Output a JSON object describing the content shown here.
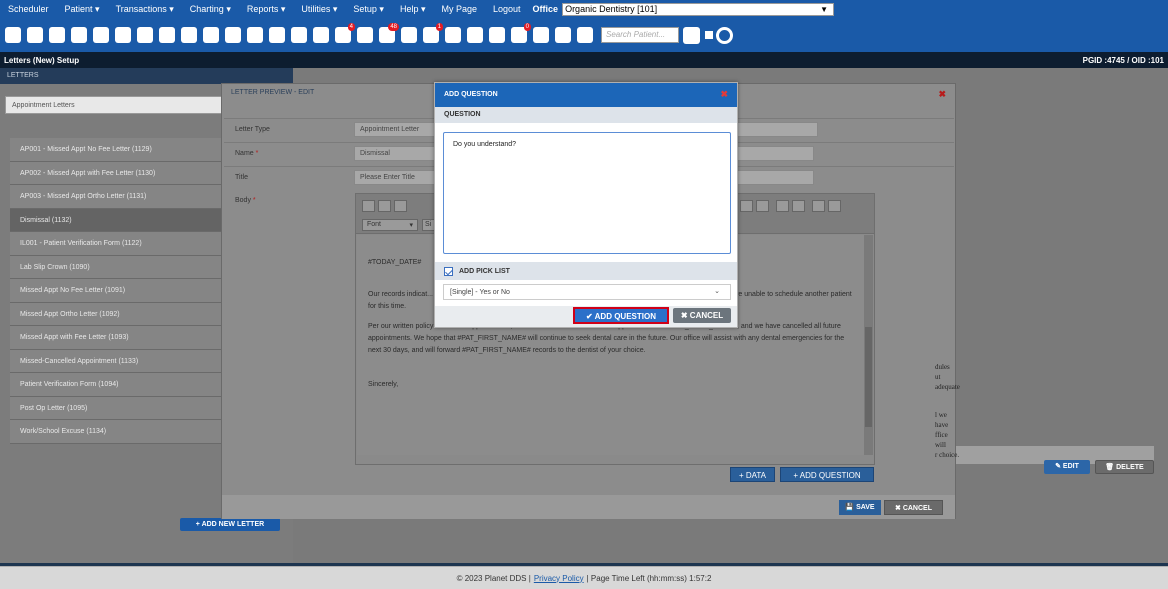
{
  "menu": {
    "items": [
      "Scheduler",
      "Patient ▾",
      "Transactions ▾",
      "Charting ▾",
      "Reports ▾",
      "Utilities ▾",
      "Setup ▾",
      "Help ▾",
      "My Page",
      "Logout"
    ],
    "office_label": "Office",
    "office_value": "Organic Dentistry [101]"
  },
  "toolbar": {
    "icons": [
      "calendar-icon",
      "home-icon",
      "dollar-icon",
      "pen-icon",
      "tooth-icon",
      "tooth-chart-icon",
      "pn-icon",
      "tx-icon",
      "family-icon",
      "family-check-icon",
      "rx-icon",
      "notes-icon",
      "printer-icon",
      "forms-icon",
      "message-icon",
      "sms-icon",
      "clock-icon",
      "globe-icon",
      "recall-icon",
      "web-icon",
      "tooth-box-icon",
      "question-box-icon",
      "settings-icon",
      "report-icon",
      "office-icon",
      "print-icon",
      "checkbox-icon"
    ],
    "badges": {
      "sms": "4",
      "globe": "48",
      "web": "1",
      "report": "0",
      "tooth": "0"
    },
    "search_placeholder": "Search Patient..."
  },
  "header": {
    "title": "Letters (New) Setup",
    "pgid": "PGID :4745 / OID :101"
  },
  "letters": {
    "heading": "LETTERS",
    "category": "Appointment Letters",
    "items": [
      "AP001 - Missed Appt No Fee Letter (1129)",
      "AP002 - Missed Appt with Fee Letter (1130)",
      "AP003 - Missed Appt Ortho Letter (1131)",
      "Dismissal (1132)",
      "IL001 - Patient Verification Form (1122)",
      "Lab Slip Crown (1090)",
      "Missed Appt No Fee Letter (1091)",
      "Missed Appt Ortho Letter (1092)",
      "Missed Appt with Fee Letter (1093)",
      "Missed-Cancelled Appointment (1133)",
      "Patient Verification Form (1094)",
      "Post Op Letter (1095)",
      "Work/School Excuse (1134)"
    ],
    "add_new": "+ ADD NEW LETTER"
  },
  "preview": {
    "title": "LETTER PREVIEW - EDIT",
    "close": "✖",
    "letter_type_label": "Letter Type",
    "letter_type_value": "Appointment Letter",
    "name_label": "Name",
    "name_value": "Dismissal",
    "title_label": "Title",
    "title_placeholder": "Please Enter Title",
    "body_label": "Body",
    "required_mark": "*",
    "font_label": "Font",
    "size_label": "Si",
    "body_paragraphs": [
      "#TODAY_DATE#",
      "Our records indicat... e do realize schedules change with little notice. Ho... und, without adequate advance notice, we are unable to schedule another patient for this time.",
      "Per our written policy on broken appointments, we cannot continue to schedule appointments for #PAT_FIRST_NAME#, and we have cancelled all future appointments. We hope that #PAT_FIRST_NAME# will continue to seek dental care in the future. Our office will assist with any dental emergencies for the next 30 days, and will forward #PAT_FIRST_NAME# records to the dentist of your choice.",
      "Sincerely,"
    ],
    "side_text": [
      "dules",
      "ut adequate",
      "",
      "",
      "l we have",
      "ffice will",
      "r choice."
    ],
    "data_button": "+ DATA",
    "add_question_button": "+ ADD QUESTION",
    "save_button": "SAVE",
    "cancel_button": "CANCEL"
  },
  "modal": {
    "title": "ADD QUESTION",
    "close": "✖",
    "section_label": "QUESTION",
    "question_text": "Do you understand?",
    "picklist_label": "ADD PICK LIST",
    "picklist_checked": true,
    "picklist_value": "[Single] - Yes or No",
    "add_button": "✔ ADD QUESTION",
    "cancel_button": "✖ CANCEL"
  },
  "right_panel": {
    "edit_button": "EDIT",
    "delete_button": "DELETE"
  },
  "footer": {
    "copyright": "© 2023 Planet DDS |",
    "privacy": "Privacy Policy",
    "page_time": "| Page Time Left (hh:mm:ss) 1:57:2"
  }
}
